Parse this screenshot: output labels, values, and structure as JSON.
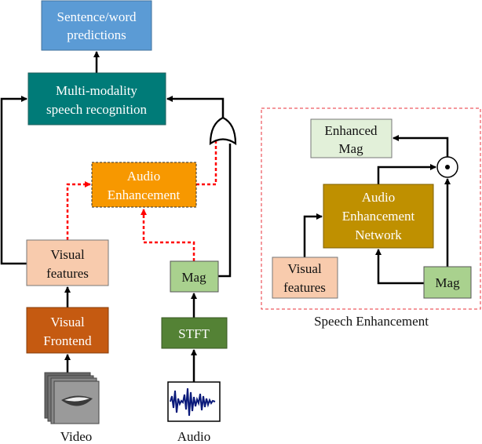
{
  "left": {
    "predictions": {
      "line1": "Sentence/word",
      "line2": "predictions",
      "color": "#5b9bd5"
    },
    "recognition": {
      "line1": "Multi-modality",
      "line2": "speech recognition",
      "color": "#007b78"
    },
    "audio_enhancement": {
      "line1": "Audio",
      "line2": "Enhancement",
      "color": "#f79800"
    },
    "visual_features": {
      "line1": "Visual",
      "line2": "features",
      "color": "#f8cbad"
    },
    "visual_frontend": {
      "line1": "Visual",
      "line2": "Frontend",
      "color": "#c55a11"
    },
    "mag": {
      "label": "Mag",
      "color": "#a9d18e"
    },
    "stft": {
      "label": "STFT",
      "color": "#548235"
    },
    "video_label": "Video",
    "audio_label": "Audio"
  },
  "right": {
    "title": "Speech Enhancement",
    "enhanced_mag": {
      "line1": "Enhanced",
      "line2": "Mag",
      "color": "#e2f0d9"
    },
    "network": {
      "line1": "Audio",
      "line2": "Enhancement",
      "line3": "Network",
      "color": "#bf9000"
    },
    "visual_features": {
      "line1": "Visual",
      "line2": "features"
    },
    "mag": {
      "label": "Mag"
    }
  },
  "colors": {
    "dashed": "#ff0000",
    "border": "#e8303a"
  }
}
